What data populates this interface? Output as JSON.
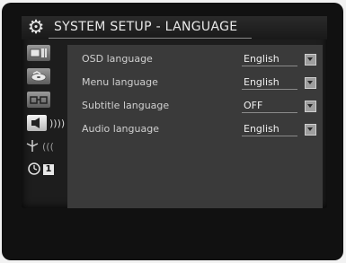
{
  "header": {
    "title": "SYSTEM SETUP - LANGUAGE",
    "icon": "gear-icon"
  },
  "sidebar": {
    "items": [
      {
        "icon": "tv-screen-icon",
        "active": false
      },
      {
        "icon": "disc-icon",
        "active": false
      },
      {
        "icon": "video-connector-icon",
        "active": false
      },
      {
        "icon": "speaker-icon",
        "active": true,
        "extra": "))))"
      },
      {
        "icon": "antenna-icon",
        "active": false,
        "extra": "((("
      },
      {
        "icon": "clock-icon",
        "active": false,
        "badge": "1"
      }
    ]
  },
  "settings": [
    {
      "label": "OSD language",
      "value": "English"
    },
    {
      "label": "Menu language",
      "value": "English"
    },
    {
      "label": "Subtitle language",
      "value": "OFF"
    },
    {
      "label": "Audio language",
      "value": "English"
    }
  ],
  "colors": {
    "background": "#1d1d1d",
    "panel": "#3a3a3a",
    "text": "#cfcfcf"
  }
}
